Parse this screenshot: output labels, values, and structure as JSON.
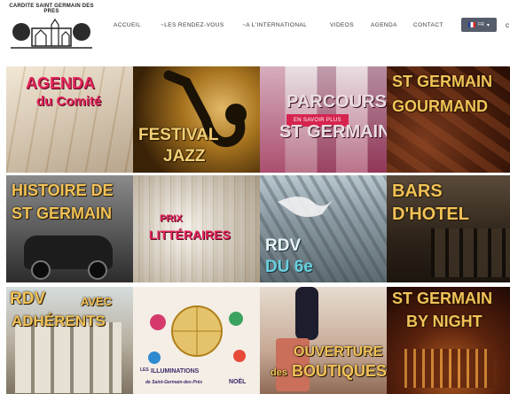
{
  "logo": {
    "text": "CARDITE SAINT GERMAIN DES PRES"
  },
  "nav": [
    {
      "label": "ACCUEIL"
    },
    {
      "label": "~LES RENDEZ-VOUS"
    },
    {
      "label": "~A L'INTERNATIONAL"
    },
    {
      "label": "VIDEOS"
    },
    {
      "label": "AGENDA"
    },
    {
      "label": "CONTACT"
    }
  ],
  "lang": {
    "label": "FR"
  },
  "tiles": [
    {
      "line1": "AGENDA",
      "line2": "du Comité"
    },
    {
      "line1": "FESTIVAL",
      "line2": "JAZZ"
    },
    {
      "line1": "PARCOURS",
      "line2": "ST GERMAIN",
      "button": "EN SAVOIR PLUS"
    },
    {
      "line1": "ST GERMAIN",
      "line2": "GOURMAND"
    },
    {
      "line1": "HISTOIRE de",
      "line2": "ST GERMAIN"
    },
    {
      "line1": "PRIX",
      "line2": "LITTÉRAIRES"
    },
    {
      "line1": "RDV",
      "line2": "DU 6e"
    },
    {
      "line1": "BARS",
      "line2": "D'HOTEL"
    },
    {
      "line1": "RDV",
      "line2": "ADHÉRENTS",
      "line3": "AVEC"
    },
    {
      "line1": "LES",
      "line2": "ILLUMINATIONS",
      "line3": "de Saint-Germain-des-Prés",
      "line4": "NOËL"
    },
    {
      "line1": "OUVERTURE",
      "line2": "BOUTIQUES",
      "line3": "des"
    },
    {
      "line1": "ST GERMAIN",
      "line2": "BY NIGHT"
    }
  ]
}
